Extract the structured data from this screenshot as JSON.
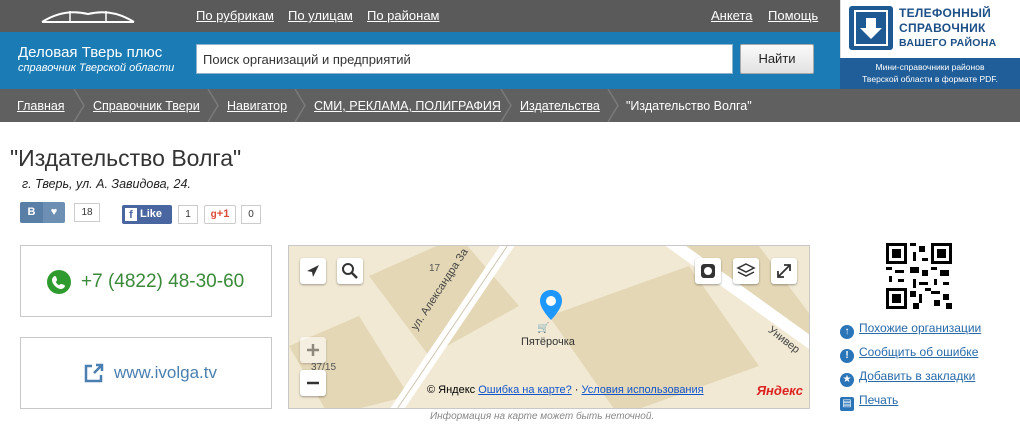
{
  "top_nav": {
    "by_category": "По рубрикам",
    "by_street": "По улицам",
    "by_district": "По районам",
    "survey": "Анкета",
    "help": "Помощь"
  },
  "brand": {
    "title": "Деловая Тверь плюс",
    "subtitle": "справочник Тверской области"
  },
  "search": {
    "value": "Поиск организаций и предприятий",
    "button": "Найти"
  },
  "promo": {
    "line1": "ТЕЛЕФОННЫЙ",
    "line2": "СПРАВОЧНИК",
    "line3": "ВАШЕГО РАЙОНА",
    "sub1": "Мини-справочники районов",
    "sub2": "Тверской области в формате PDF."
  },
  "breadcrumb": [
    "Главная",
    "Справочник Твери",
    "Навигатор",
    "СМИ, РЕКЛАМА, ПОЛИГРАФИЯ",
    "Издательства",
    "\"Издательство Волга\""
  ],
  "org": {
    "title": "\"Издательство Волга\"",
    "address": "г. Тверь, ул. А. Завидова, 24."
  },
  "social": {
    "vk_letter": "В",
    "vk_count": "18",
    "fb_label": "Like",
    "fb_count": "1",
    "gplus_label": "+1",
    "gplus_count": "0"
  },
  "contacts": {
    "phone": "+7 (4822) 48-30-60",
    "website": "www.ivolga.tv"
  },
  "map": {
    "street": "ул. Александра За",
    "street2": "Универ",
    "house_17": "17",
    "house_37_15": "37/15",
    "poi": "Пятёрочка",
    "copyright": "© Яндекс",
    "report_error": "Ошибка на карте?",
    "separator": "·",
    "terms": "Условия использования",
    "yandex_logo": "Яндекс",
    "note": "Информация на карте может быть неточной."
  },
  "sidebar": {
    "similar": "Похожие организации",
    "report": "Сообщить об ошибке",
    "bookmark": "Добавить в закладки",
    "print": "Печать"
  },
  "colors": {
    "brand_blue": "#1b7cb5",
    "topbar_gray": "#5a5a5a",
    "phone_green": "#3a8a3a",
    "link_blue": "#2a6aa8"
  }
}
